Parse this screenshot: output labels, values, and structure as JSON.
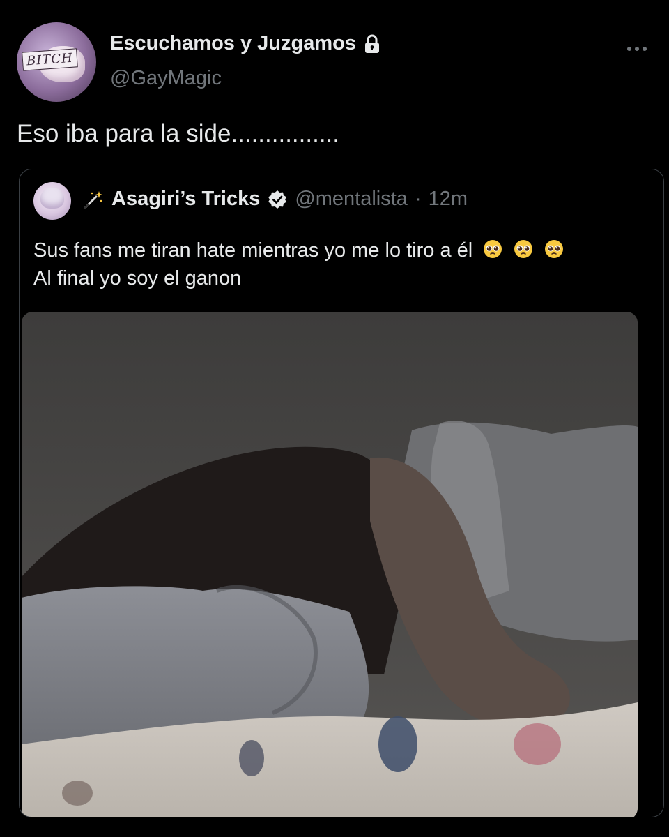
{
  "tweet": {
    "author": {
      "display_name": "Escuchamos y Juzgamos",
      "handle": "@GayMagic",
      "avatar_text": "BITCH",
      "avatar_icon": "avatar-pig-image",
      "protected_icon": "lock-icon"
    },
    "more_icon": "more-horizontal-icon",
    "text": "Eso iba para la side................"
  },
  "quoted_tweet": {
    "author": {
      "name_prefix_icon": "magic-wand-icon",
      "display_name": "Asagiri’s Tricks",
      "verified_icon": "verified-badge-icon",
      "handle": "@mentalista",
      "separator": "·",
      "time": "12m"
    },
    "text_lines": [
      "Sus fans me tiran hate mientras yo me lo tiro a él",
      "Al final yo soy el ganon"
    ],
    "emoji": "pleading-face-icon",
    "emoji_count": 3,
    "media": {
      "type": "photo",
      "description_icon": "photo-person-hugging-pillow"
    }
  },
  "colors": {
    "background": "#000000",
    "text_primary": "#e7e9ea",
    "text_secondary": "#71767b",
    "card_border": "#3a3f44"
  }
}
